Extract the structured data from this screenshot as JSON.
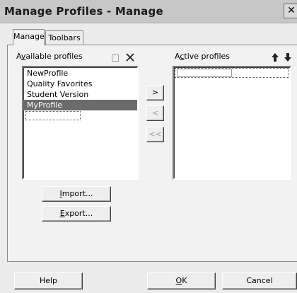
{
  "window": {
    "title": "Manage Profiles - Manage",
    "close_glyph": "✕"
  },
  "tabs": [
    {
      "label": "Manage"
    },
    {
      "label": "Toolbars"
    }
  ],
  "available": {
    "label_pre": "A",
    "label_u": "v",
    "label_post": "ailable profiles",
    "items": [
      "NewProfile",
      "Quality Favorites",
      "Student Version",
      "MyProfile"
    ],
    "selected_index": 3
  },
  "active": {
    "label_pre": "A",
    "label_u": "c",
    "label_post": "tive profiles",
    "items": []
  },
  "buttons": {
    "add": ">",
    "remove": "<",
    "remove_all": "<<",
    "import_u": "I",
    "import_post": "mport...",
    "export_u": "E",
    "export_post": "xport...",
    "help": "Help",
    "ok_u": "O",
    "ok_post": "K",
    "cancel": "Cancel"
  },
  "icons": {
    "new_icon": "new-profile-icon",
    "delete_icon": "delete-icon",
    "up_icon": "move-up-arrow-icon",
    "down_icon": "move-down-arrow-icon"
  }
}
